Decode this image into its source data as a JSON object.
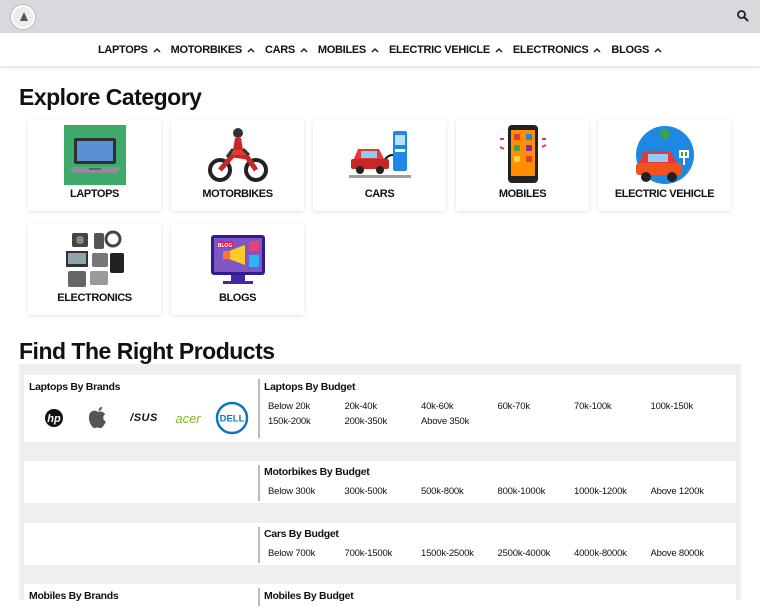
{
  "nav": {
    "items": [
      {
        "label": "LAPTOPS"
      },
      {
        "label": "MOTORBIKES"
      },
      {
        "label": "CARS"
      },
      {
        "label": "MOBILES"
      },
      {
        "label": "ELECTRIC VEHICLE"
      },
      {
        "label": "ELECTRONICS"
      },
      {
        "label": "BLOGS"
      }
    ]
  },
  "explore": {
    "title": "Explore Category",
    "categories": [
      {
        "label": "LAPTOPS",
        "icon": "laptop-icon"
      },
      {
        "label": "MOTORBIKES",
        "icon": "motorbike-icon"
      },
      {
        "label": "CARS",
        "icon": "car-charging-icon"
      },
      {
        "label": "MOBILES",
        "icon": "mobile-phone-icon"
      },
      {
        "label": "ELECTRIC VEHICLE",
        "icon": "electric-vehicle-icon"
      },
      {
        "label": "ELECTRONICS",
        "icon": "electronics-icon"
      },
      {
        "label": "BLOGS",
        "icon": "blog-icon"
      }
    ]
  },
  "products": {
    "title": "Find The Right Products",
    "laptops": {
      "brands_title": "Laptops By Brands",
      "brands": [
        {
          "label": "hp",
          "icon": "hp-logo"
        },
        {
          "label": "",
          "icon": "apple-logo"
        },
        {
          "label": "/SUS",
          "icon": "asus-logo"
        },
        {
          "label": "acer",
          "icon": "acer-logo"
        },
        {
          "label": "DELL",
          "icon": "dell-logo"
        }
      ],
      "budget_title": "Laptops By Budget",
      "budgets": [
        "Below 20k",
        "20k-40k",
        "40k-60k",
        "60k-70k",
        "70k-100k",
        "100k-150k",
        "150k-200k",
        "200k-350k",
        "Above 350k"
      ]
    },
    "motorbikes": {
      "budget_title": "Motorbikes By Budget",
      "budgets": [
        "Below 300k",
        "300k-500k",
        "500k-800k",
        "800k-1000k",
        "1000k-1200k",
        "Above 1200k"
      ]
    },
    "cars": {
      "budget_title": "Cars By Budget",
      "budgets": [
        "Below 700k",
        "700k-1500k",
        "1500k-2500k",
        "2500k-4000k",
        "4000k-8000k",
        "Above 8000k"
      ]
    },
    "mobiles": {
      "brands_title": "Mobiles By Brands",
      "budget_title": "Mobiles By Budget"
    }
  },
  "colors": {
    "topbar": "#d7d9dd",
    "section_bg": "#efefef",
    "text": "#111111",
    "acer_green": "#83b81a",
    "dell_blue": "#0a77c4"
  }
}
